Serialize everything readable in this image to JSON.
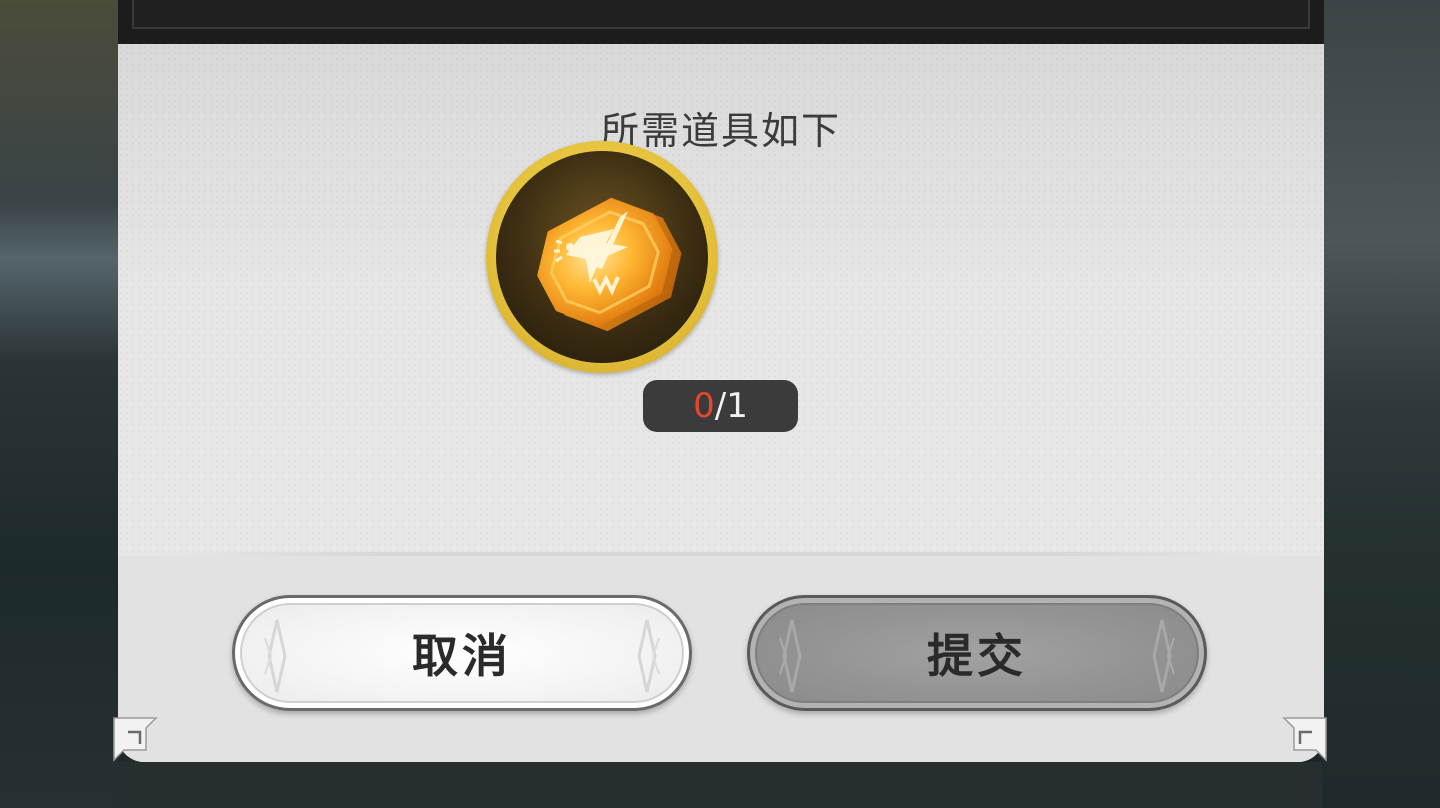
{
  "dialog": {
    "title": "所需道具如下"
  },
  "required_item": {
    "icon": "golden-crest-token-icon",
    "have": "0",
    "separator": "/",
    "need": "1"
  },
  "buttons": {
    "cancel_label": "取消",
    "submit_label": "提交"
  },
  "colors": {
    "have_count": "#e8472f",
    "item_ring": "#e6c33c",
    "submit_disabled": "#939393"
  }
}
